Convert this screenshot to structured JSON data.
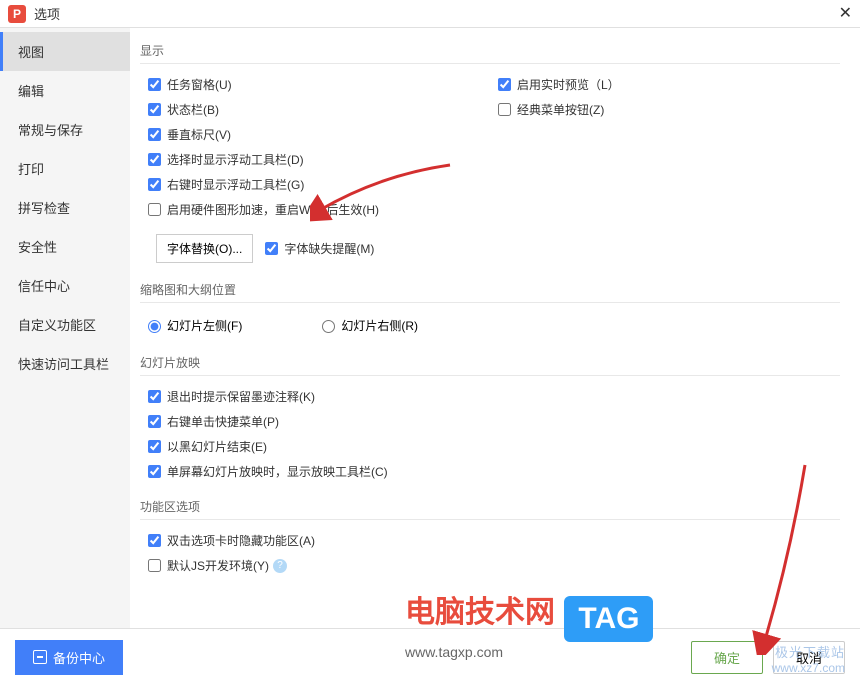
{
  "window": {
    "icon_letter": "P",
    "title": "选项"
  },
  "sidebar": {
    "items": [
      {
        "label": "视图"
      },
      {
        "label": "编辑"
      },
      {
        "label": "常规与保存"
      },
      {
        "label": "打印"
      },
      {
        "label": "拼写检查"
      },
      {
        "label": "安全性"
      },
      {
        "label": "信任中心"
      },
      {
        "label": "自定义功能区"
      },
      {
        "label": "快速访问工具栏"
      }
    ]
  },
  "sections": {
    "display": {
      "title": "显示",
      "task_pane": "任务窗格(U)",
      "realtime_preview": "启用实时预览（L）",
      "status_bar": "状态栏(B)",
      "classic_menu": "经典菜单按钮(Z)",
      "ruler": "垂直标尺(V)",
      "select_toolbar": "选择时显示浮动工具栏(D)",
      "right_click_toolbar": "右键时显示浮动工具栏(G)",
      "hardware_accel": "启用硬件图形加速，重启WPS后生效(H)",
      "font_sub_button": "字体替换(O)...",
      "font_missing": "字体缺失提醒(M)"
    },
    "thumb": {
      "title": "缩略图和大纲位置",
      "slide_left": "幻灯片左侧(F)",
      "slide_right": "幻灯片右侧(R)"
    },
    "slideshow": {
      "title": "幻灯片放映",
      "keep_ink": "退出时提示保留墨迹注释(K)",
      "right_menu": "右键单击快捷菜单(P)",
      "black_end": "以黑幻灯片结束(E)",
      "single_screen": "单屏幕幻灯片放映时，显示放映工具栏(C)"
    },
    "ribbon": {
      "title": "功能区选项",
      "dbl_click": "双击选项卡时隐藏功能区(A)",
      "js_env": "默认JS开发环境(Y)"
    }
  },
  "footer": {
    "backup": "备份中心",
    "confirm": "确定",
    "cancel": "取消"
  },
  "overlay": {
    "logo_text": "电脑技术网",
    "tag_text": "TAG",
    "url": "www.tagxp.com",
    "watermark_brand": "极光下载站",
    "watermark_url": "www.xz7.com"
  }
}
